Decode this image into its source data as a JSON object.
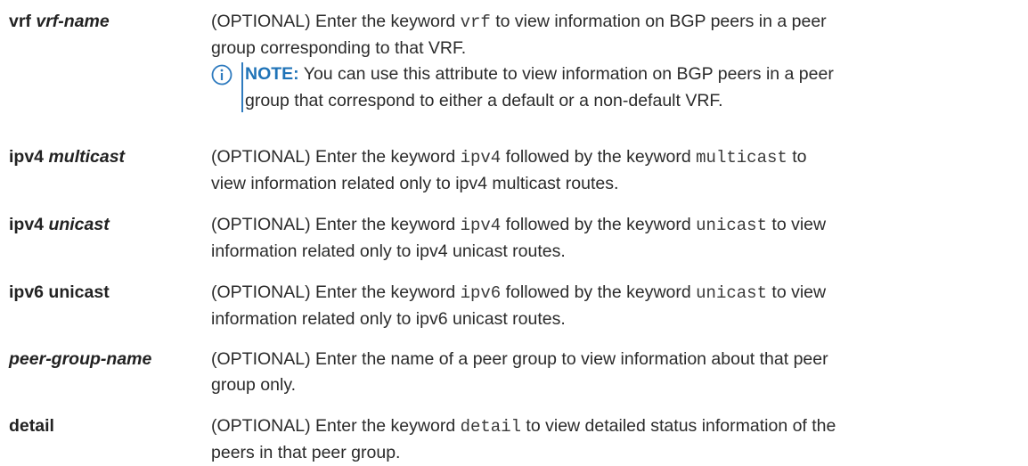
{
  "rows": [
    {
      "term_plain": "vrf ",
      "term_italic": "vrf-name",
      "desc_line1": "(OPTIONAL) Enter the keyword ",
      "desc_code1": "vrf",
      "desc_line1_rest": " to view information on BGP peers in a peer",
      "desc_line2": "group corresponding to that VRF.",
      "note_label": "NOTE:",
      "note_line1": " You can use this attribute to view information on BGP peers in a peer",
      "note_line2": "group that correspond to either a default or a non-default VRF.",
      "note_icon": "info-icon"
    },
    {
      "term_plain": "ipv4 ",
      "term_italic": "multicast",
      "desc_pre": "(OPTIONAL) Enter the keyword ",
      "desc_code1": "ipv4",
      "desc_mid": " followed by the keyword ",
      "desc_code2": "multicast",
      "desc_post": " to",
      "desc_line2": "view information related only to ipv4 multicast routes."
    },
    {
      "term_plain": "ipv4 ",
      "term_italic": "unicast",
      "desc_pre": "(OPTIONAL) Enter the keyword ",
      "desc_code1": "ipv4",
      "desc_mid": " followed by the keyword ",
      "desc_code2": "unicast",
      "desc_post": " to view",
      "desc_line2": "information related only to ipv4 unicast routes."
    },
    {
      "term_plain": "ipv6 unicast",
      "desc_pre": "(OPTIONAL) Enter the keyword ",
      "desc_code1": "ipv6",
      "desc_mid": " followed by the keyword ",
      "desc_code2": "unicast",
      "desc_post": " to view",
      "desc_line2": "information related only to ipv6 unicast routes."
    },
    {
      "term_italic": "peer-group-name",
      "desc_line1": "(OPTIONAL) Enter the name of a peer group to view information about that peer",
      "desc_line2": "group only."
    },
    {
      "term_plain": "detail",
      "desc_pre": "(OPTIONAL) Enter the keyword ",
      "desc_code1": "detail",
      "desc_post": " to view detailed status information of the",
      "desc_line2": "peers in that peer group."
    }
  ]
}
